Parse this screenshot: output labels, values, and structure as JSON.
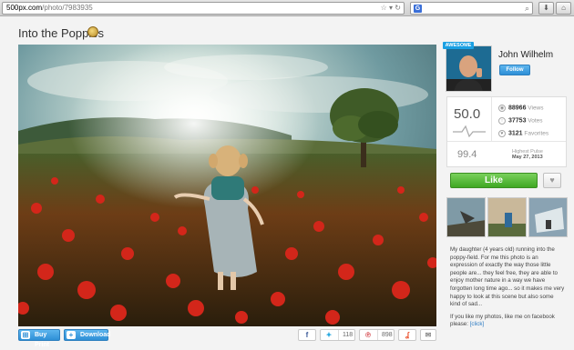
{
  "browser": {
    "url_host": "500px.com",
    "url_path": "/photo/7983935",
    "search_engine_letter": "G"
  },
  "photo": {
    "title": "Into the Poppies"
  },
  "actions": {
    "buy_print_label": "Buy Print",
    "download_label": "Download"
  },
  "share": {
    "twitter_count": "118",
    "pinterest_count": "898"
  },
  "author": {
    "badge": "AWESOME",
    "name": "John Wilhelm",
    "follow_label": "Follow"
  },
  "stats": {
    "pulse": "50.0",
    "highest_pulse": "99.4",
    "views_count": "88966",
    "views_label": "Views",
    "votes_count": "37753",
    "votes_label": "Votes",
    "favorites_count": "3121",
    "favorites_label": "Favorites",
    "highest_pulse_label": "Highest Pulse",
    "highest_pulse_date": "May 27, 2013"
  },
  "like_label": "Like",
  "description": {
    "paragraph1": "My daughter (4 years old) running into the poppy-field. For me this photo is an expression of exactly the way those little people are... they feel free, they are able to enjoy mother nature in a way we have forgotten long time ago... so it makes me very happy to look at this scene but also some kind of sad...",
    "paragraph2": "If you like my photos, like me on facebook please:",
    "link_text": "[click]"
  },
  "colors": {
    "accent_blue": "#2e8fd6",
    "like_green": "#3fa823",
    "badge_blue": "#1aa0e3"
  }
}
